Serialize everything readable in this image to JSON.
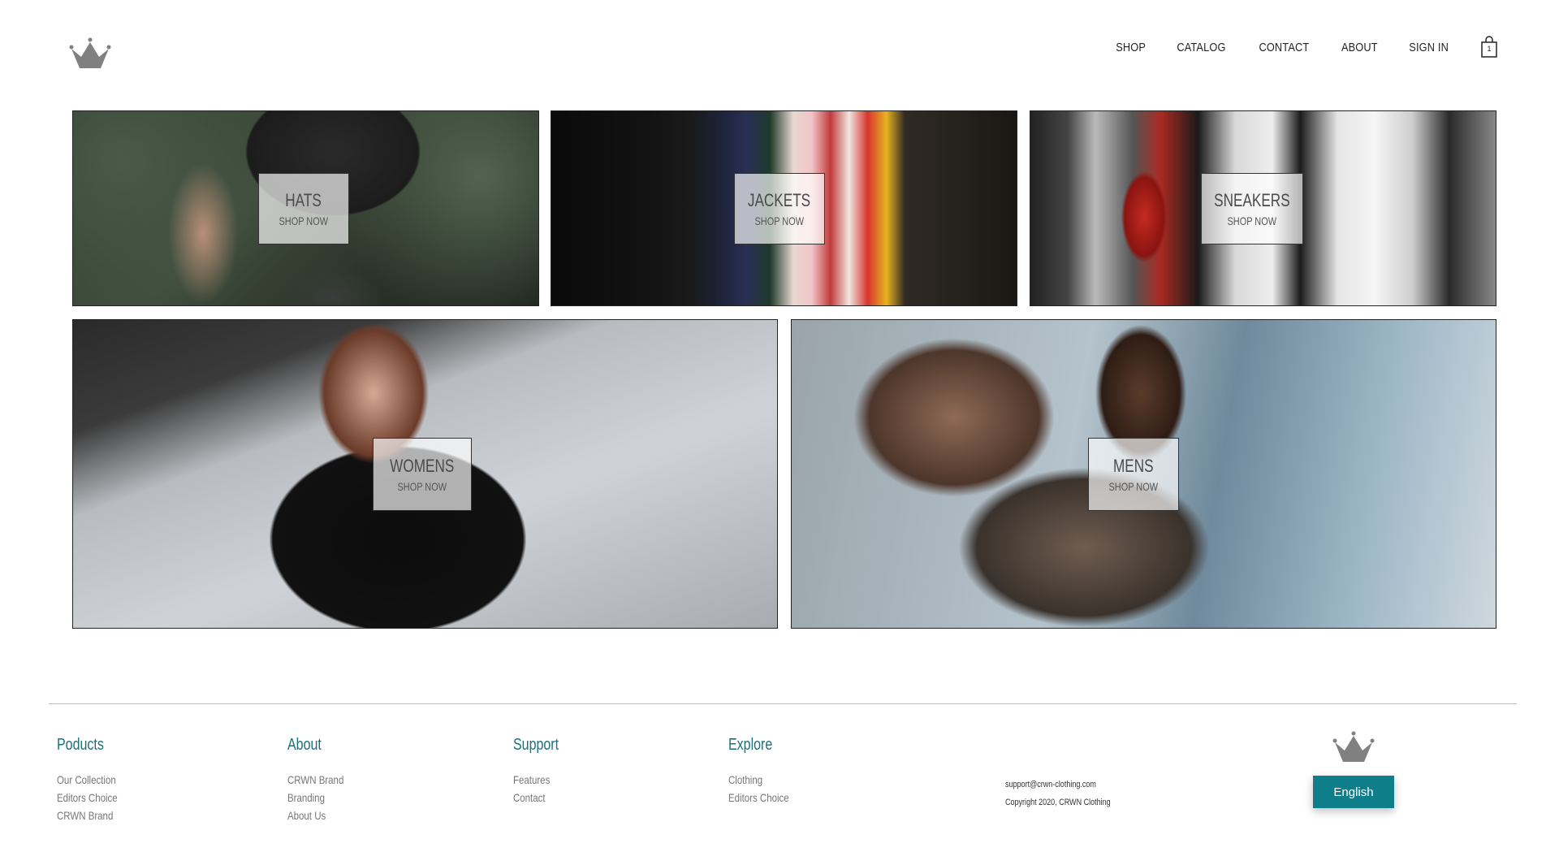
{
  "nav": {
    "links": [
      "SHOP",
      "CATALOG",
      "CONTACT",
      "ABOUT",
      "SIGN IN"
    ],
    "cart_count": "1"
  },
  "tiles": [
    {
      "title": "HATS",
      "subtitle": "SHOP NOW"
    },
    {
      "title": "JACKETS",
      "subtitle": "SHOP NOW"
    },
    {
      "title": "SNEAKERS",
      "subtitle": "SHOP NOW"
    },
    {
      "title": "WOMENS",
      "subtitle": "SHOP NOW"
    },
    {
      "title": "MENS",
      "subtitle": "SHOP NOW"
    }
  ],
  "footer": {
    "columns": [
      {
        "heading": "Poducts",
        "links": [
          "Our Collection",
          "Editors Choice",
          "CRWN Brand"
        ]
      },
      {
        "heading": "About",
        "links": [
          "CRWN Brand",
          "Branding",
          "About Us"
        ]
      },
      {
        "heading": "Support",
        "links": [
          "Features",
          "Contact"
        ]
      },
      {
        "heading": "Explore",
        "links": [
          "Clothing",
          "Editors Choice"
        ]
      }
    ],
    "email": "support@crwn-clothing.com",
    "copyright": "Copyright 2020, CRWN Clothing",
    "language_button": "English"
  },
  "colors": {
    "accent": "#0d7e8a",
    "footer_heading": "#1e6f7a"
  },
  "icons": {
    "logo": "crown-icon",
    "cart": "shopping-bag-icon"
  }
}
